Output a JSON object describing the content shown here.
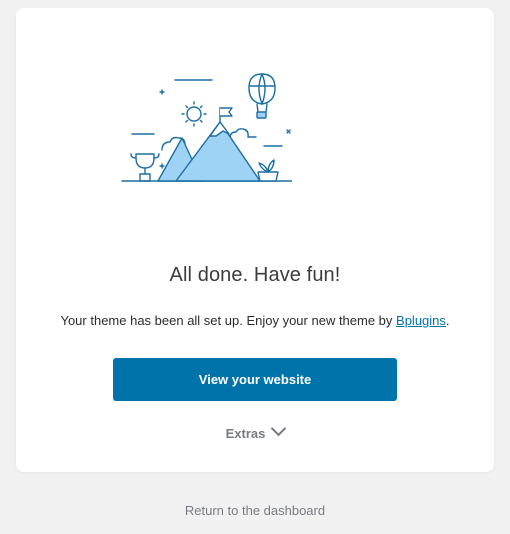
{
  "card": {
    "title": "All done. Have fun!",
    "subtitle_prefix": "Your theme has been all set up. Enjoy your new theme by ",
    "subtitle_link": "Bplugins",
    "subtitle_suffix": ".",
    "primary_button_label": "View your website",
    "extras_label": "Extras"
  },
  "footer": {
    "return_label": "Return to the dashboard"
  },
  "colors": {
    "accent": "#0073aa",
    "illustration_stroke": "#1c6ea4",
    "mountain_fill": "#9fd3f5",
    "page_background": "#f1f1f1",
    "card_background": "#ffffff"
  },
  "icons": {
    "illustration": "mountain-balloon-trophy-illustration",
    "extras_toggle": "chevron-down-icon"
  }
}
